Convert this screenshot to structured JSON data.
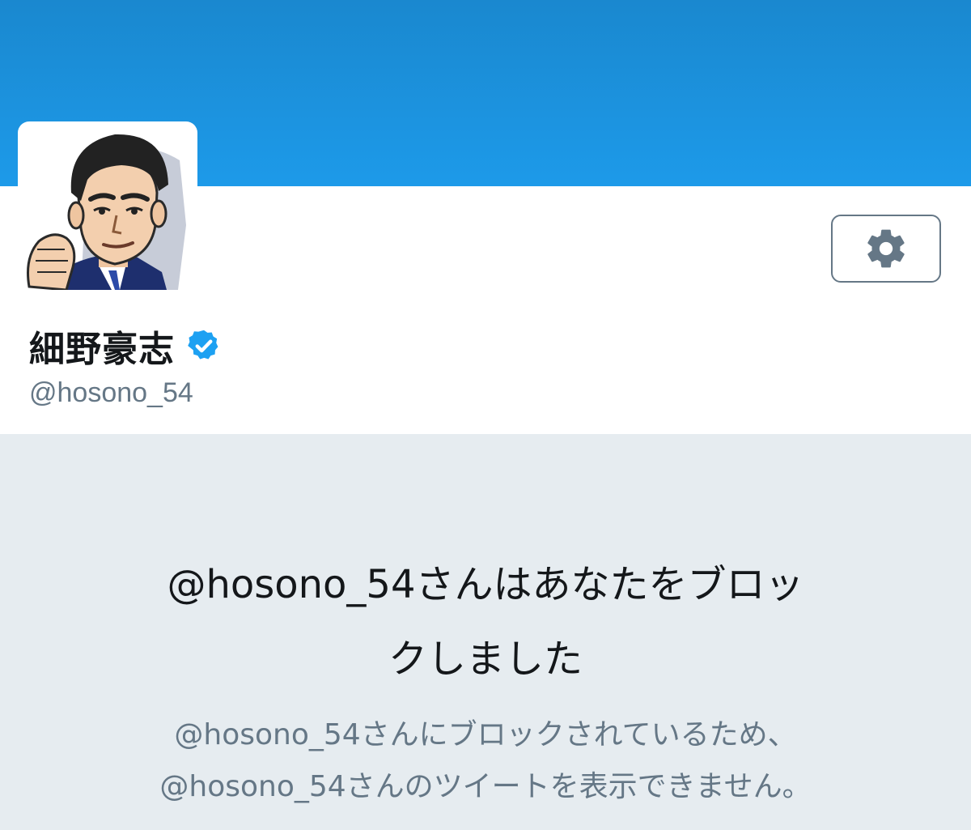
{
  "profile": {
    "display_name": "細野豪志",
    "handle": "@hosono_54",
    "verified": true,
    "avatar_alt": "cartoon avatar"
  },
  "toolbar": {
    "settings_icon": "gear-icon"
  },
  "blocked_notice": {
    "title_line1": "@hosono_54さんはあなたをブロッ",
    "title_line2": "クしました",
    "subtitle_line1": "@hosono_54さんにブロックされているため、",
    "subtitle_line2": "@hosono_54さんのツイートを表示できません。"
  },
  "colors": {
    "banner": "#1d9ae9",
    "verified_badge": "#1da1f2",
    "secondary_text": "#657786",
    "background": "#e6ecf0"
  }
}
